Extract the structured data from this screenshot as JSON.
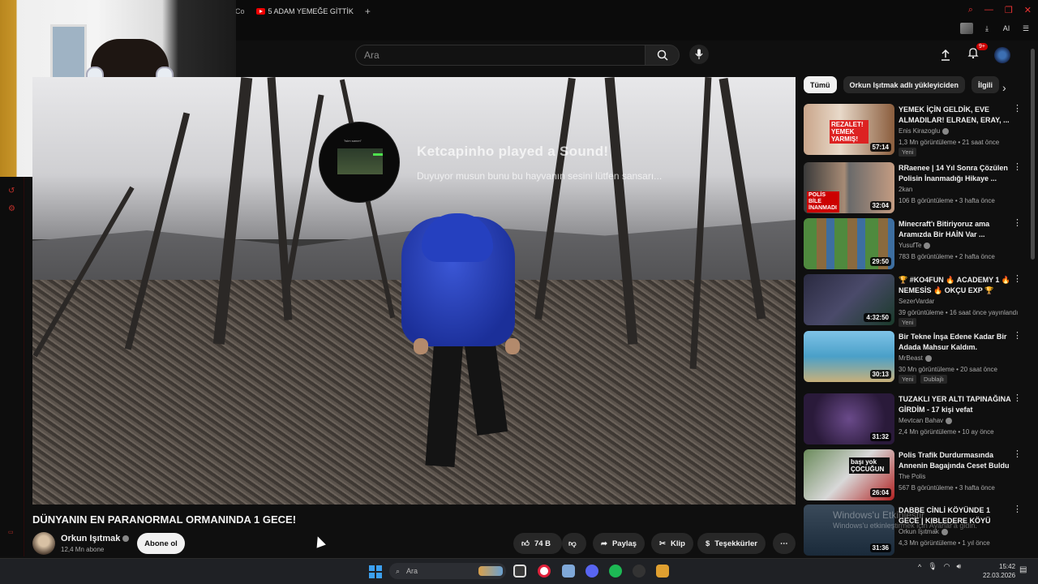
{
  "browser": {
    "tab_title": "5 ADAM YEMEĞE GİTTİK",
    "tab_prefix_fragment": "Co",
    "new_tab_label": "+",
    "toolbar_ai_label": "AI"
  },
  "header": {
    "search_placeholder": "Ara",
    "notification_count": "9+"
  },
  "overlay": {
    "sound_title": "Ketcapinho played a Sound!",
    "sound_subtitle": "Duyuyor musun bunu bu hayvanın sesini lütfen sansarı...",
    "sound_mini_label": "\"isim sanım\""
  },
  "video": {
    "title": "DÜNYANIN EN PARANORMAL ORMANINDA 1 GECE!",
    "channel": "Orkun Işıtmak",
    "subscribers": "12,4 Mn abone",
    "subscribe_label": "Abone ol",
    "likes": "74 B",
    "share_label": "Paylaş",
    "clip_label": "Klip",
    "thanks_label": "Teşekkürler"
  },
  "sidebar": {
    "chips": [
      "Tümü",
      "Orkun Işıtmak adlı yükleyiciden",
      "İlgili"
    ],
    "recommendations": [
      {
        "title": "YEMEK İÇİN GELDİK, EVE ALMADILAR! ELRAEN, ERAY, ...",
        "channel": "Enis Kirazoglu",
        "meta": "1,3 Mn görüntüleme • 21 saat önce",
        "duration": "57:14",
        "badge": "Yeni",
        "thumb_text": "REZALET! YEMEK YARMIŞ!"
      },
      {
        "title": "RRaenee | 14 Yıl Sonra Çözülen Polisin İnanmadığı Hikaye ...",
        "channel": "2kan",
        "meta": "106 B görüntüleme • 3 hafta önce",
        "duration": "32:04",
        "thumb_text": "POLİS BİLE İNANMADI"
      },
      {
        "title": "Minecraft'ı Bitiriyoruz ama Aramızda Bir HAİN Var ...",
        "channel": "YusufTe",
        "meta": "783 B görüntüleme • 2 hafta önce",
        "duration": "29:50"
      },
      {
        "title": "🏆 #KO4FUN 🔥 ACADEMY 1 🔥 NEMESİS 🔥 OKÇU EXP 🏆",
        "channel": "SezerVardar",
        "meta": "39 görüntüleme • 16 saat önce yayınlandı",
        "duration": "4:32:50",
        "badge": "Yeni"
      },
      {
        "title": "Bir Tekne İnşa Edene Kadar Bir Adada Mahsur Kaldım.",
        "channel": "MrBeast",
        "meta": "30 Mn görüntüleme • 20 saat önce",
        "duration": "30:13",
        "badge": "Yeni",
        "badge2": "Dublajlı"
      },
      {
        "title": "TUZAKLI YER ALTI TAPINAĞINA GİRDİM - 17 kişi vefat",
        "channel": "Mevtcan Bahav",
        "meta": "2,4 Mn görüntüleme • 10 ay önce",
        "duration": "31:32"
      },
      {
        "title": "Polis Trafik Durdurmasında Annenin Bagajında Ceset Buldu",
        "channel": "The Polis",
        "meta": "567 B görüntüleme • 3 hafta önce",
        "duration": "26:04",
        "thumb_text": "başı yok ÇOCUĞUN"
      },
      {
        "title": "DABBE CİNLİ KÖYÜNDE 1 GECE | KIBLEDERE KÖYÜ",
        "channel": "Orkun Işıtmak",
        "meta": "4,3 Mn görüntüleme • 1 yıl önce",
        "duration": "31:36"
      }
    ]
  },
  "watermark": {
    "line1": "Windows'u Etkinleştir",
    "line2": "Windows'u etkinleştirmek için Ayarlar'a gidin."
  },
  "taskbar": {
    "search_label": "Ara",
    "time": "15:42",
    "date": "22.03.2026"
  },
  "colors": {
    "background": "#0f0f0f",
    "accent_red": "#cc0000",
    "chip_active": "#f1f1f1",
    "jacket_blue": "#2540bf"
  }
}
